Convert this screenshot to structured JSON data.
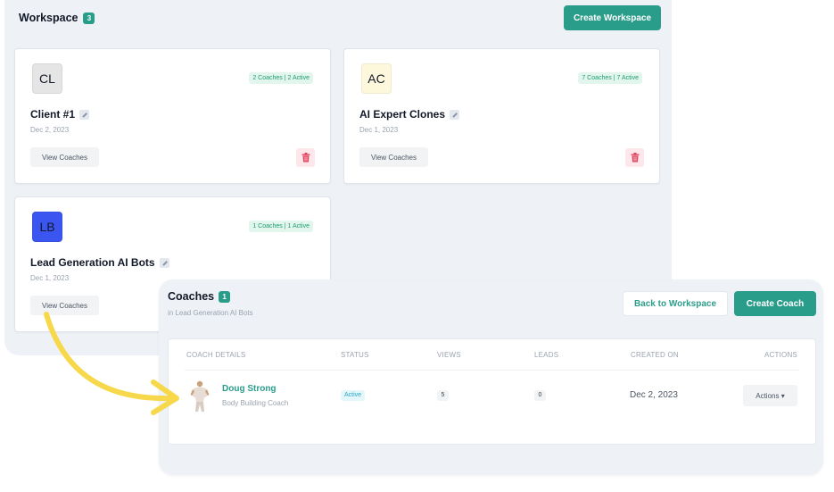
{
  "workspace": {
    "title": "Workspace",
    "count": "3",
    "create_button": "Create Workspace",
    "cards": [
      {
        "initials": "CL",
        "avatar_color": "#e5e5e5",
        "name": "Client #1",
        "date": "Dec 2, 2023",
        "badge": "2 Coaches | 2 Active",
        "view_button": "View Coaches",
        "deletable": true
      },
      {
        "initials": "AC",
        "avatar_color": "#fdf8dc",
        "name": "AI Expert Clones",
        "date": "Dec 1, 2023",
        "badge": "7 Coaches | 7 Active",
        "view_button": "View Coaches",
        "deletable": true
      },
      {
        "initials": "LB",
        "avatar_color": "#3a55f0",
        "name": "Lead Generation AI Bots",
        "date": "Dec 1, 2023",
        "badge": "1 Coaches | 1 Active",
        "view_button": "View Coaches",
        "deletable": false
      }
    ]
  },
  "coaches": {
    "title": "Coaches",
    "count": "1",
    "subtitle": "in Lead Generation AI Bots",
    "back_button": "Back to Workspace",
    "create_button": "Create Coach",
    "columns": [
      "COACH DETAILS",
      "STATUS",
      "VIEWS",
      "LEADS",
      "CREATED ON",
      "ACTIONS"
    ],
    "rows": [
      {
        "name": "Doug Strong",
        "role": "Body Building Coach",
        "status": "Active",
        "views": "5",
        "leads": "0",
        "created": "Dec 2, 2023",
        "actions": "Actions ▾"
      }
    ]
  },
  "colors": {
    "accent": "#2a9d8a",
    "panel": "#eef2f7",
    "delete_bg": "#fde7ea",
    "delete_icon": "#e0455f",
    "arrow": "#f6d84a"
  },
  "icons": [
    "edit-pencil-icon",
    "trash-icon",
    "curved-arrow-icon",
    "caret-down-icon"
  ]
}
